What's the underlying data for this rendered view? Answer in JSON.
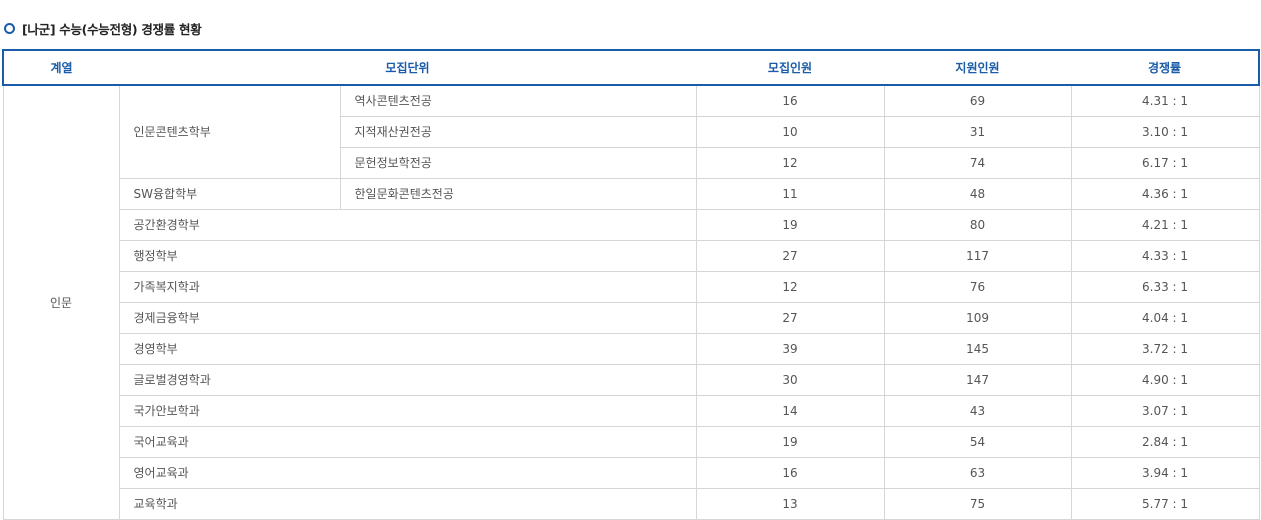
{
  "section_title": "[나군] 수능(수능전형) 경쟁률 현황",
  "headers": {
    "category": "계열",
    "unit": "모집단위",
    "quota": "모집인원",
    "applicants": "지원인원",
    "rate": "경쟁률"
  },
  "category": "인문",
  "groups": [
    {
      "name": "인문콘텐츠학부",
      "majors": [
        {
          "name": "역사콘텐츠전공",
          "quota": "16",
          "applicants": "69",
          "rate": "4.31 : 1"
        },
        {
          "name": "지적재산권전공",
          "quota": "10",
          "applicants": "31",
          "rate": "3.10 : 1"
        },
        {
          "name": "문헌정보학전공",
          "quota": "12",
          "applicants": "74",
          "rate": "6.17 : 1"
        }
      ]
    },
    {
      "name": "SW융합학부",
      "majors": [
        {
          "name": "한일문화콘텐츠전공",
          "quota": "11",
          "applicants": "48",
          "rate": "4.36 : 1"
        }
      ]
    }
  ],
  "departments": [
    {
      "name": "공간환경학부",
      "quota": "19",
      "applicants": "80",
      "rate": "4.21 : 1"
    },
    {
      "name": "행정학부",
      "quota": "27",
      "applicants": "117",
      "rate": "4.33 : 1"
    },
    {
      "name": "가족복지학과",
      "quota": "12",
      "applicants": "76",
      "rate": "6.33 : 1"
    },
    {
      "name": "경제금융학부",
      "quota": "27",
      "applicants": "109",
      "rate": "4.04 : 1"
    },
    {
      "name": "경영학부",
      "quota": "39",
      "applicants": "145",
      "rate": "3.72 : 1"
    },
    {
      "name": "글로벌경영학과",
      "quota": "30",
      "applicants": "147",
      "rate": "4.90 : 1"
    },
    {
      "name": "국가안보학과",
      "quota": "14",
      "applicants": "43",
      "rate": "3.07 : 1"
    },
    {
      "name": "국어교육과",
      "quota": "19",
      "applicants": "54",
      "rate": "2.84 : 1"
    },
    {
      "name": "영어교육과",
      "quota": "16",
      "applicants": "63",
      "rate": "3.94 : 1"
    },
    {
      "name": "교육학과",
      "quota": "13",
      "applicants": "75",
      "rate": "5.77 : 1"
    }
  ],
  "colors": {
    "accent": "#1b5ca8",
    "border": "#d6d6d6"
  },
  "icons": {
    "bullet": "circle-bullet-icon"
  }
}
